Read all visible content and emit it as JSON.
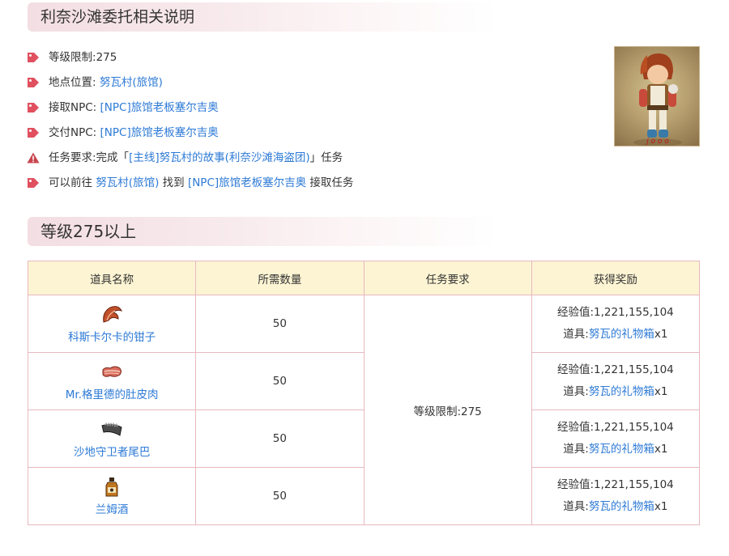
{
  "section1": {
    "title": "利奈沙滩委托相关说明"
  },
  "info": {
    "level": {
      "label": "等级限制:",
      "value": "275"
    },
    "location": {
      "label": "地点位置: ",
      "link": "努瓦村(旅馆)"
    },
    "accept": {
      "label": "接取NPC: ",
      "link": "[NPC]旅馆老板塞尔吉奥"
    },
    "deliver": {
      "label": "交付NPC: ",
      "link": "[NPC]旅馆老板塞尔吉奥"
    },
    "requirement": {
      "label": "任务要求:完成「",
      "link": "[主线]努瓦村的故事(利奈沙滩海盗团)",
      "suffix": "」任务"
    },
    "howto": {
      "prefix": "可以前往 ",
      "link1": "努瓦村(旅馆)",
      "middle": " 找到 ",
      "link2": "[NPC]旅馆老板塞尔吉奥",
      "suffix": " 接取任务"
    }
  },
  "section2": {
    "title": "等级275以上"
  },
  "table": {
    "headers": [
      "道具名称",
      "所需数量",
      "任务要求",
      "获得奖励"
    ],
    "requirement": "等级限制:275",
    "rows": [
      {
        "name": "科斯卡尔卡的钳子",
        "qty": "50",
        "exp": "经验值:1,221,155,104",
        "item_label": "道具:",
        "item_link": "努瓦的礼物箱",
        "item_qty": "x1",
        "icon": "claw-icon"
      },
      {
        "name": "Mr.格里德的肚皮肉",
        "qty": "50",
        "exp": "经验值:1,221,155,104",
        "item_label": "道具:",
        "item_link": "努瓦的礼物箱",
        "item_qty": "x1",
        "icon": "meat-icon"
      },
      {
        "name": "沙地守卫者尾巴",
        "qty": "50",
        "exp": "经验值:1,221,155,104",
        "item_label": "道具:",
        "item_link": "努瓦的礼物箱",
        "item_qty": "x1",
        "icon": "tail-icon"
      },
      {
        "name": "兰姆酒",
        "qty": "50",
        "exp": "经验值:1,221,155,104",
        "item_label": "道具:",
        "item_link": "努瓦的礼物箱",
        "item_qty": "x1",
        "icon": "rum-bottle-icon"
      }
    ]
  },
  "colors": {
    "link": "#2d7ad6",
    "tag_icon": "#e0505f",
    "warn_icon": "#c8464f",
    "table_border": "#e7b9c0",
    "header_bg": "#fdf4d3"
  }
}
